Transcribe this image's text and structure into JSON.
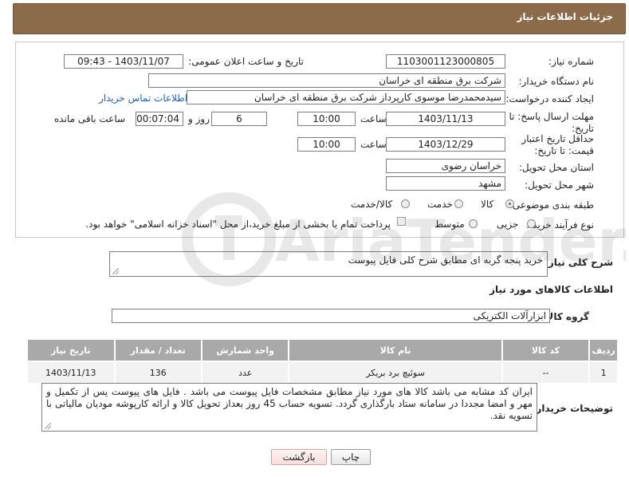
{
  "header": {
    "title": "جزئیات اطلاعات نیاز"
  },
  "form": {
    "need_number_label": "شماره نیاز:",
    "need_number": "1103001123000805",
    "announce_label": "تاریخ و ساعت اعلان عمومی:",
    "announce_value": "1403/11/07 - 09:43",
    "buyer_org_label": "نام دستگاه خریدار:",
    "buyer_org": "شرکت برق منطقه ای خراسان",
    "requester_label": "ایجاد کننده درخواست:",
    "requester": "سیدمحمدرضا موسوی کارپرداز شرکت برق منطقه ای خراسان",
    "contact_link": "اطلاعات تماس خریدار",
    "deadline_label": "مهلت ارسال پاسخ: تا تاریخ:",
    "deadline_date": "1403/11/13",
    "time_label": "ساعت",
    "deadline_time": "10:00",
    "days_value": "6",
    "days_label": "روز و",
    "remaining_time": "00:07:04",
    "remaining_label": "ساعت باقی مانده",
    "validity_label": "حداقل تاریخ اعتبار قیمت: تا تاریخ:",
    "validity_date": "1403/12/29",
    "validity_time_label": "ساعت",
    "validity_time": "10:00",
    "province_label": "استان محل تحویل:",
    "province": "خراسان رضوی",
    "city_label": "شهر محل تحویل:",
    "city": "مشهد",
    "category_label": "طبقه بندی موضوعی:",
    "category_options": [
      "کالا",
      "خدمت",
      "کالا/خدمت"
    ],
    "category_selected": "کالا",
    "process_label": "نوع فرآیند خرید :",
    "process_options": [
      "جزیی",
      "متوسط"
    ],
    "payment_note": "پرداخت تمام یا بخشی از مبلغ خرید،از محل \"اسناد خزانه اسلامی\" خواهد بود."
  },
  "summary": {
    "label": "شرح کلی نیاز:",
    "value": "خرید پنجه گربه ای مطابق شرح کلی فایل پیوست"
  },
  "goods": {
    "section_title": "اطلاعات کالاهای مورد نیاز",
    "group_label": "گروه کالا:",
    "group_value": "ابزارآلات الکتریکی",
    "columns": [
      "ردیف",
      "کد کالا",
      "نام کالا",
      "واحد شمارش",
      "تعداد / مقدار",
      "تاریخ نیاز"
    ],
    "rows": [
      {
        "index": "1",
        "code": "--",
        "name": "سوئیچ برد بریکر",
        "unit": "عدد",
        "qty": "136",
        "date": "1403/11/13"
      }
    ]
  },
  "notes": {
    "label": "توضیحات خریدار:",
    "value": "ایران کد مشابه می باشد کالا های مورد نیاز مطابق مشخصات فایل پیوست می باشد . فایل های پیوست پس از تکمیل و مهر و امضا مجددا در سامانه ستاد بارگذاری گردد. تسویه حساب 45 روز بعداز تحویل کالا و ارائه کارپوشه مودیان مالیاتی با تسویه نقد."
  },
  "buttons": {
    "print": "چاپ",
    "back": "بازگشت"
  },
  "watermark": {
    "text": "AriaTender.net"
  },
  "colors": {
    "header_bg": "#8b6b4a",
    "table_header": "#a9a9a9",
    "link": "#1f5fbf"
  }
}
